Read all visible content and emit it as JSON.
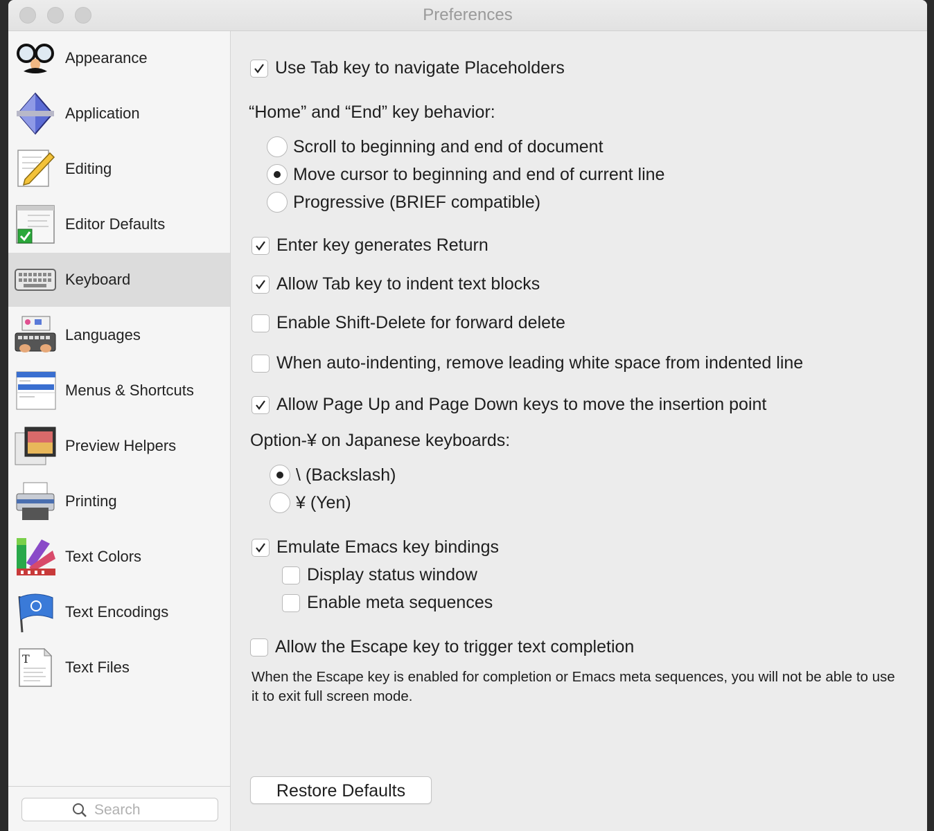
{
  "window": {
    "title": "Preferences"
  },
  "sidebar": {
    "items": [
      {
        "label": "Appearance",
        "icon": "glasses-disguise-icon"
      },
      {
        "label": "Application",
        "icon": "application-gem-icon"
      },
      {
        "label": "Editing",
        "icon": "pencil-document-icon"
      },
      {
        "label": "Editor Defaults",
        "icon": "editor-defaults-check-icon"
      },
      {
        "label": "Keyboard",
        "icon": "keyboard-icon",
        "selected": true
      },
      {
        "label": "Languages",
        "icon": "languages-keyboard-icon"
      },
      {
        "label": "Menus & Shortcuts",
        "icon": "menu-icon"
      },
      {
        "label": "Preview Helpers",
        "icon": "preview-window-icon"
      },
      {
        "label": "Printing",
        "icon": "printer-icon"
      },
      {
        "label": "Text Colors",
        "icon": "color-swatches-icon"
      },
      {
        "label": "Text Encodings",
        "icon": "flag-icon"
      },
      {
        "label": "Text Files",
        "icon": "text-file-icon"
      }
    ],
    "search_placeholder": "Search"
  },
  "keyboard": {
    "tab_placeholders": {
      "label": "Use Tab key to navigate Placeholders",
      "checked": true
    },
    "home_end_heading": "“Home” and “End” key behavior:",
    "home_end_options": [
      {
        "label": "Scroll to beginning and end of document",
        "selected": false
      },
      {
        "label": "Move cursor to beginning and end of current line",
        "selected": true
      },
      {
        "label": "Progressive (BRIEF compatible)",
        "selected": false
      }
    ],
    "enter_return": {
      "label": "Enter key generates Return",
      "checked": true
    },
    "tab_indent": {
      "label": "Allow Tab key to indent text blocks",
      "checked": true
    },
    "shift_delete": {
      "label": "Enable Shift-Delete for forward delete",
      "checked": false
    },
    "auto_indent": {
      "label": "When auto-indenting, remove leading white space from indented line",
      "checked": false
    },
    "page_up_down": {
      "label": "Allow Page Up and Page Down keys to move the insertion point",
      "checked": true
    },
    "yen_heading": "Option-¥ on Japanese keyboards:",
    "yen_options": [
      {
        "label": "\\ (Backslash)",
        "selected": true
      },
      {
        "label": "¥ (Yen)",
        "selected": false
      }
    ],
    "emacs": {
      "label": "Emulate Emacs key bindings",
      "checked": true
    },
    "emacs_status": {
      "label": "Display status window",
      "checked": false
    },
    "emacs_meta": {
      "label": "Enable meta sequences",
      "checked": false
    },
    "escape_completion": {
      "label": "Allow the Escape key to trigger text completion",
      "checked": false
    },
    "escape_note": "When the Escape key is enabled for completion or Emacs meta sequences, you will not be able to use it to exit full screen mode.",
    "restore_label": "Restore Defaults"
  }
}
